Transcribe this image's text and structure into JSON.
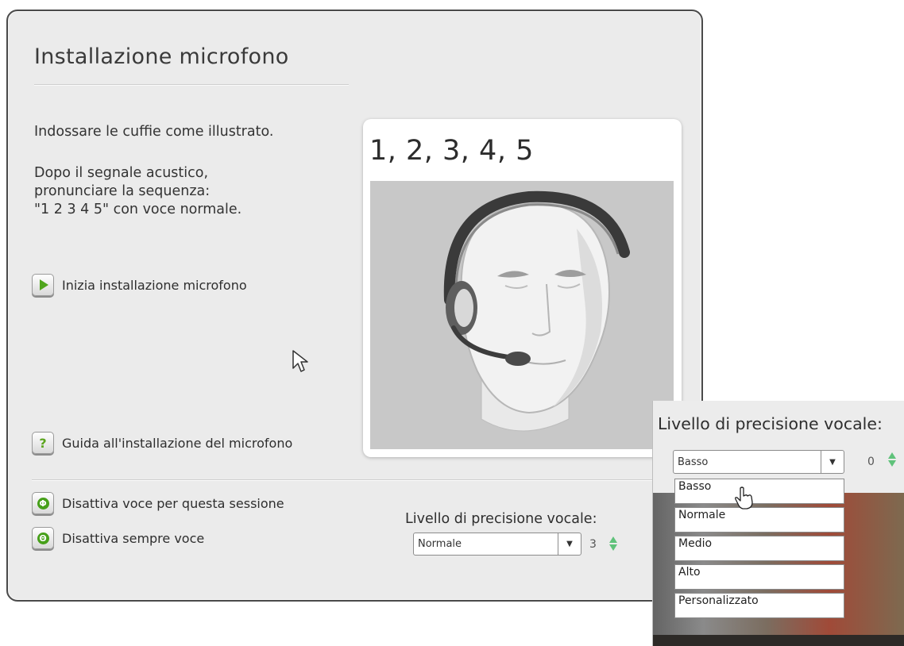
{
  "dialog": {
    "title": "Installazione microfono",
    "instruction_1": "Indossare le cuffie come illustrato.",
    "instruction_2": "Dopo il segnale acustico,\npronunciare la sequenza:\n\"1 2 3 4 5\" con voce normale.",
    "start_button": {
      "label": "Inizia installazione microfono",
      "icon": "play-icon"
    },
    "help_button": {
      "label": "Guida all'installazione del microfono",
      "icon": "question-icon",
      "glyph": "?"
    },
    "illustration": {
      "sequence": "1, 2, 3, 4, 5"
    },
    "disable_session_button": {
      "label": "Disattiva voce per questa sessione",
      "icon": "power-icon",
      "glyph": "Φ"
    },
    "disable_always_button": {
      "label": "Disattiva sempre voce",
      "icon": "minus-circle-icon",
      "glyph": "Θ"
    },
    "precision": {
      "label": "Livello di precisione vocale:",
      "selected": "Normale",
      "value": "3"
    }
  },
  "dropdown_inset": {
    "label": "Livello di precisione vocale:",
    "selected": "Basso",
    "value": "0",
    "options": [
      "Basso",
      "Normale",
      "Medio",
      "Alto",
      "Personalizzato"
    ]
  },
  "colors": {
    "accent_green": "#4fa51c",
    "spinner_green": "#5fc27a",
    "dialog_background": "#ebebeb"
  }
}
